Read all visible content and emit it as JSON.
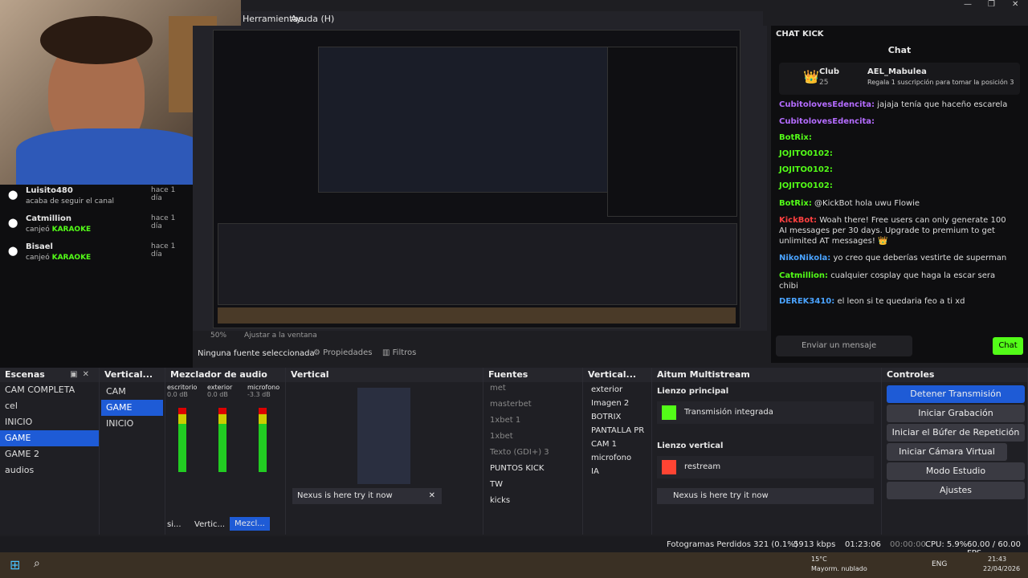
{
  "menu": {
    "items": [
      "Herramientas",
      "Ayuda (H)"
    ]
  },
  "preview": {
    "zoom": "50%",
    "fit": "Ajustar a la ventana"
  },
  "source_bar": {
    "none": "Ninguna fuente seleccionada",
    "props": "Propiedades",
    "filters": "Filtros"
  },
  "activity": [
    {
      "user": "Luisito480",
      "text": "acaba de seguir el canal",
      "time": "hace 1 día"
    },
    {
      "user": "Catmillion",
      "action": "canjeó",
      "reward": "KARAOKE",
      "time": "hace 1 día"
    },
    {
      "user": "Bisael",
      "action": "canjeó",
      "reward": "KARAOKE",
      "time": "hace 1 día"
    }
  ],
  "chat": {
    "dock_title": "CHAT KICK",
    "title": "Chat",
    "club": "Club",
    "club_count": "25",
    "top_user": "AEL_Mabulea",
    "top_note": "Regala 1 suscripción para tomar la posición 3",
    "messages": [
      {
        "user": "CubitolovesEdencita:",
        "text": "jajaja tenía que haceño escarela"
      },
      {
        "user": "CubitolovesEdencita:",
        "text": ""
      },
      {
        "user": "BotRix:",
        "text": ""
      },
      {
        "user": "JOJITO0102:",
        "text": ""
      },
      {
        "user": "JOJITO0102:",
        "text": ""
      },
      {
        "user": "JOJITO0102:",
        "text": ""
      },
      {
        "user": "BotRix:",
        "text": "@KickBot hola uwu Flowie"
      },
      {
        "user": "KickBot:",
        "text": "Woah there! Free users can only generate 100 AI messages per 30 days. Upgrade to premium to get unlimited AT messages! 👑"
      },
      {
        "user": "NikoNikola:",
        "text": "yo creo que deberías vestirte de superman"
      },
      {
        "user": "Catmillion:",
        "text": "cualquier cosplay que haga la escar sera chibi"
      },
      {
        "user": "DEREK3410:",
        "text": "el leon si te quedaria feo a ti xd"
      }
    ],
    "input_placeholder": "Enviar un mensaje",
    "send": "Chat"
  },
  "docks": {
    "scenes": {
      "title": "Escenas",
      "items": [
        "CAM COMPLETA",
        "cel",
        "INICIO",
        "GAME",
        "GAME 2",
        "audios"
      ],
      "selected": 3
    },
    "vertical_scenes": {
      "title": "Vertical...",
      "items": [
        "CAM",
        "GAME",
        "INICIO"
      ],
      "selected": 1
    },
    "mixer": {
      "title": "Mezclador de audio",
      "channels": [
        {
          "name": "escritorio",
          "db": "0.0 dB"
        },
        {
          "name": "exterior",
          "db": "0.0 dB"
        },
        {
          "name": "microfono",
          "db": "-3.3 dB"
        }
      ],
      "tabs": [
        "si...",
        "Vertic...",
        "Mezcl..."
      ]
    },
    "vertical": {
      "title": "Vertical",
      "banner": "Nexus is here try it now"
    },
    "sources": {
      "title": "Fuentes",
      "items": [
        "met",
        "masterbet",
        "1xbet 1",
        "1xbet",
        "Texto (GDI+) 3",
        "PUNTOS KICK",
        "TW",
        "kicks"
      ]
    },
    "vertical_sources": {
      "title": "Vertical...",
      "items": [
        "exterior",
        "Imagen 2",
        "BOTRIX",
        "PANTALLA PR",
        "CAM 1",
        "microfono",
        "IA"
      ]
    },
    "multistream": {
      "title": "Aitum Multistream",
      "main": "Lienzo principal",
      "main_item": "Transmisión integrada",
      "vertical": "Lienzo vertical",
      "vertical_item": "restream",
      "banner": "Nexus is here try it now"
    },
    "controls": {
      "title": "Controles",
      "buttons": [
        "Detener Transmisión",
        "Iniciar Grabación",
        "Iniciar el Búfer de Repetición",
        "Iniciar Cámara Virtual",
        "Modo Estudio",
        "Ajustes"
      ]
    }
  },
  "status": {
    "dropped": "Fotogramas Perdidos 321 (0.1%)",
    "kbps": "5913 kbps",
    "live_time": "01:23:06",
    "rec_time": "00:00:00",
    "cpu": "CPU: 5.9%",
    "fps": "60.00 / 60.00 FPS"
  },
  "taskbar": {
    "weather": "15°C",
    "weather_desc": "Mayorm. nublado",
    "lang": "ENG",
    "time": "21:43",
    "date": "22/04/2026"
  }
}
